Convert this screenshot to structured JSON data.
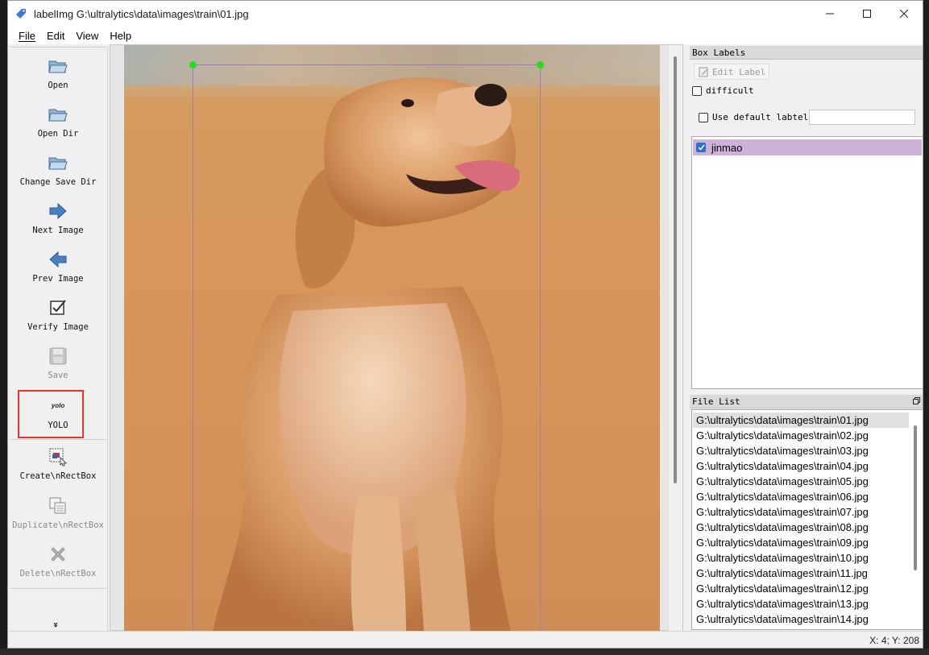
{
  "window": {
    "title": "labelImg G:\\ultralytics\\data\\images\\train\\01.jpg"
  },
  "menu": [
    {
      "label": "File",
      "mnemonic": "F"
    },
    {
      "label": "Edit",
      "mnemonic": "E"
    },
    {
      "label": "View",
      "mnemonic": "V"
    },
    {
      "label": "Help",
      "mnemonic": "H"
    }
  ],
  "toolbar": {
    "open": "Open",
    "open_dir": "Open Dir",
    "change_save_dir": "Change Save Dir",
    "next_image": "Next Image",
    "prev_image": "Prev Image",
    "verify_image": "Verify Image",
    "save": "Save",
    "format_glyph": "yolo",
    "format": "YOLO",
    "create_rect": "Create\\nRectBox",
    "duplicate_rect": "Duplicate\\nRectBox",
    "delete_rect": "Delete\\nRectBox",
    "more": "»"
  },
  "box_labels": {
    "title": "Box Labels",
    "edit_label": "Edit Label",
    "difficult": "difficult",
    "use_default_label": "Use default labtel",
    "default_label_value": "",
    "items": [
      {
        "label": "jinmao",
        "checked": true
      }
    ]
  },
  "file_list": {
    "title": "File List",
    "selected_index": 0,
    "files": [
      "G:\\ultralytics\\data\\images\\train\\01.jpg",
      "G:\\ultralytics\\data\\images\\train\\02.jpg",
      "G:\\ultralytics\\data\\images\\train\\03.jpg",
      "G:\\ultralytics\\data\\images\\train\\04.jpg",
      "G:\\ultralytics\\data\\images\\train\\05.jpg",
      "G:\\ultralytics\\data\\images\\train\\06.jpg",
      "G:\\ultralytics\\data\\images\\train\\07.jpg",
      "G:\\ultralytics\\data\\images\\train\\08.jpg",
      "G:\\ultralytics\\data\\images\\train\\09.jpg",
      "G:\\ultralytics\\data\\images\\train\\10.jpg",
      "G:\\ultralytics\\data\\images\\train\\11.jpg",
      "G:\\ultralytics\\data\\images\\train\\12.jpg",
      "G:\\ultralytics\\data\\images\\train\\13.jpg",
      "G:\\ultralytics\\data\\images\\train\\14.jpg"
    ]
  },
  "status": {
    "coords": "X: 4; Y: 208"
  },
  "colors": {
    "bbox": "#a07ac0",
    "bbox_handle": "#22dd22",
    "label_highlight": "#cdb1d9",
    "format_highlight": "#e8352a"
  }
}
